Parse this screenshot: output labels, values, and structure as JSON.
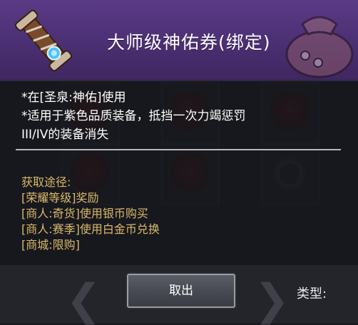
{
  "item": {
    "title": "大师级神佑券(绑定)",
    "description": [
      "*在[圣泉:神佑]使用",
      "*适用于紫色品质装备，抵挡一次力竭惩罚",
      "III/IV的装备消失"
    ],
    "obtain_header": "获取途径:",
    "obtain_methods": [
      "[荣耀等级]奖励",
      "[商人:奇货]使用银币购买",
      "[商人:赛季]使用白金币兑换",
      "[商城:限购]"
    ],
    "rarity_color": "#5a3a86",
    "icon": "scroll-icon"
  },
  "bottom": {
    "cancel_label": "取出",
    "type_label": "类型:"
  },
  "colors": {
    "obtain_text": "#d9b86a",
    "header_bg": "#4b2f73"
  }
}
